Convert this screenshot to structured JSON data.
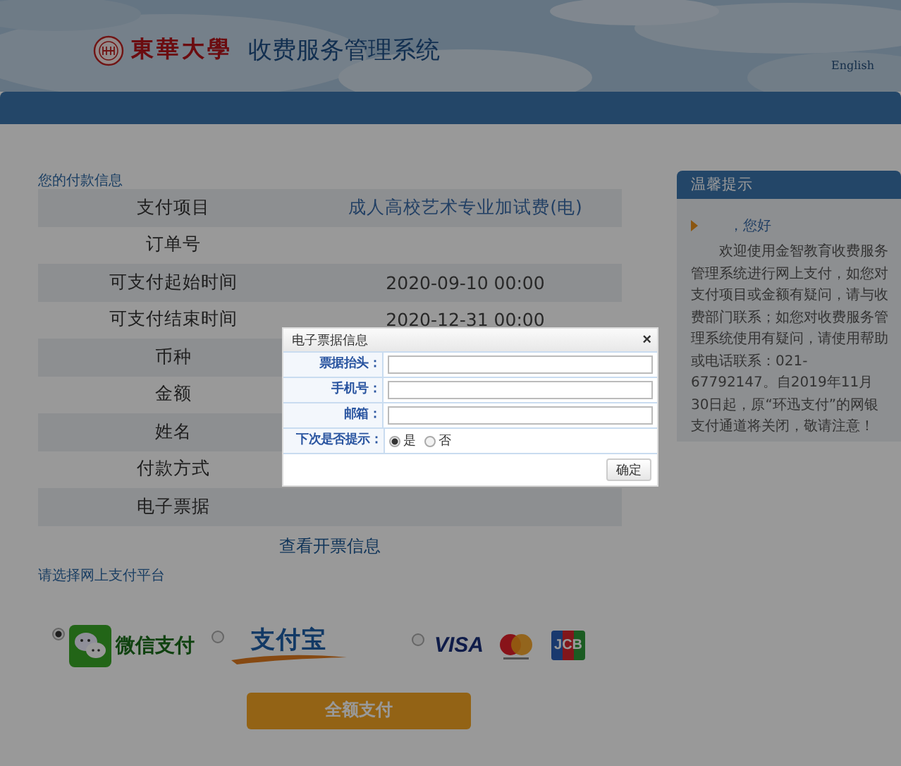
{
  "header": {
    "logo_text": "東華大學",
    "system_title": "收费服务管理系统",
    "language_link": "English"
  },
  "payment_info": {
    "title": "您的付款信息",
    "rows": [
      {
        "label": "支付项目",
        "value": "成人高校艺术专业加试费(电)"
      },
      {
        "label": "订单号"
      },
      {
        "label": "可支付起始时间",
        "value": "2020-09-10 00:00"
      },
      {
        "label": "可支付结束时间",
        "value": "2020-12-31 00:00"
      },
      {
        "label": "币种"
      },
      {
        "label": "金额"
      },
      {
        "label": "姓名"
      },
      {
        "label": "付款方式"
      },
      {
        "label": "电子票据"
      }
    ],
    "invoice_link": "查看开票信息"
  },
  "sidebar": {
    "title": "温馨提示",
    "greeting": "，您好",
    "message": "欢迎使用金智教育收费服务管理系统进行网上支付，如您对支付项目或金额有疑问，请与收费部门联系；如您对收费服务管理系统使用有疑问，请使用帮助或电话联系：021-67792147。自2019年11月30日起，原“环迅支付”的网银支付通道将关闭，敬请注意！"
  },
  "platforms": {
    "title": "请选择网上支付平台",
    "options": [
      {
        "kind": "wechat",
        "label": "微信支付",
        "selected": true
      },
      {
        "kind": "alipay",
        "label": "支付宝",
        "selected": false
      },
      {
        "kind": "cards",
        "labels": [
          "VISA",
          "JCB"
        ],
        "selected": false
      }
    ]
  },
  "pay_button": "全额支付",
  "dialog": {
    "title": "电子票据信息",
    "close": "×",
    "fields": [
      {
        "kind": "text",
        "label": "票据抬头："
      },
      {
        "kind": "text",
        "label": "手机号："
      },
      {
        "kind": "text",
        "label": "邮箱："
      },
      {
        "kind": "radio",
        "label": "下次是否提示：",
        "options": [
          {
            "label": "是",
            "selected": true
          },
          {
            "label": "否",
            "selected": false
          }
        ]
      }
    ],
    "button": "确定"
  }
}
